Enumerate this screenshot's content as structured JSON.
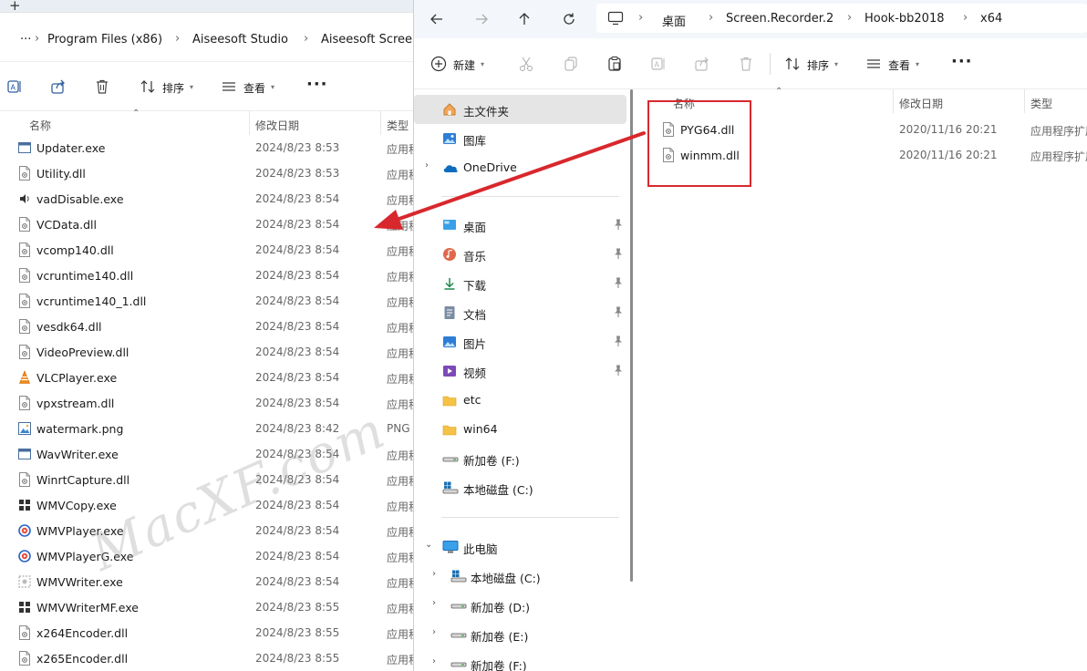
{
  "left": {
    "tab_plus": "+",
    "breadcrumb_more": "···",
    "breadcrumb": [
      "Program Files (x86)",
      "Aiseesoft Studio",
      "Aiseesoft Screen"
    ],
    "toolbar": {
      "sort_label": "排序",
      "view_label": "查看",
      "more": "···"
    },
    "columns": {
      "name": "名称",
      "date": "修改日期",
      "type": "类型"
    },
    "files": [
      {
        "name": "Updater.exe",
        "date": "2024/8/23 8:53",
        "type": "应用程",
        "icon": "app-window-icon"
      },
      {
        "name": "Utility.dll",
        "date": "2024/8/23 8:53",
        "type": "应用程",
        "icon": "dll-file-icon"
      },
      {
        "name": "vadDisable.exe",
        "date": "2024/8/23 8:54",
        "type": "应用程",
        "icon": "speaker-app-icon"
      },
      {
        "name": "VCData.dll",
        "date": "2024/8/23 8:54",
        "type": "应用程",
        "icon": "dll-file-icon"
      },
      {
        "name": "vcomp140.dll",
        "date": "2024/8/23 8:54",
        "type": "应用程",
        "icon": "dll-file-icon"
      },
      {
        "name": "vcruntime140.dll",
        "date": "2024/8/23 8:54",
        "type": "应用程",
        "icon": "dll-file-icon"
      },
      {
        "name": "vcruntime140_1.dll",
        "date": "2024/8/23 8:54",
        "type": "应用程",
        "icon": "dll-file-icon"
      },
      {
        "name": "vesdk64.dll",
        "date": "2024/8/23 8:54",
        "type": "应用程",
        "icon": "dll-file-icon"
      },
      {
        "name": "VideoPreview.dll",
        "date": "2024/8/23 8:54",
        "type": "应用程",
        "icon": "dll-file-icon"
      },
      {
        "name": "VLCPlayer.exe",
        "date": "2024/8/23 8:54",
        "type": "应用程",
        "icon": "vlc-cone-icon"
      },
      {
        "name": "vpxstream.dll",
        "date": "2024/8/23 8:54",
        "type": "应用程",
        "icon": "dll-file-icon"
      },
      {
        "name": "watermark.png",
        "date": "2024/8/23 8:42",
        "type": "PNG",
        "icon": "image-file-icon"
      },
      {
        "name": "WavWriter.exe",
        "date": "2024/8/23 8:54",
        "type": "应用程",
        "icon": "app-window-icon"
      },
      {
        "name": "WinrtCapture.dll",
        "date": "2024/8/23 8:54",
        "type": "应用程",
        "icon": "dll-file-icon"
      },
      {
        "name": "WMVCopy.exe",
        "date": "2024/8/23 8:54",
        "type": "应用程",
        "icon": "grid-app-icon"
      },
      {
        "name": "WMVPlayer.exe",
        "date": "2024/8/23 8:54",
        "type": "应用程",
        "icon": "media-player-icon"
      },
      {
        "name": "WMVPlayerG.exe",
        "date": "2024/8/23 8:54",
        "type": "应用程",
        "icon": "media-player-icon"
      },
      {
        "name": "WMVWriter.exe",
        "date": "2024/8/23 8:54",
        "type": "应用程",
        "icon": "dotted-app-icon"
      },
      {
        "name": "WMVWriterMF.exe",
        "date": "2024/8/23 8:55",
        "type": "应用程",
        "icon": "grid-app-icon"
      },
      {
        "name": "x264Encoder.dll",
        "date": "2024/8/23 8:55",
        "type": "应用程",
        "icon": "dll-file-icon"
      },
      {
        "name": "x265Encoder.dll",
        "date": "2024/8/23 8:55",
        "type": "应用程",
        "icon": "dll-file-icon"
      }
    ]
  },
  "right": {
    "breadcrumb": [
      "桌面",
      "Screen.Recorder.2",
      "Hook-bb2018",
      "x64"
    ],
    "toolbar": {
      "new_label": "新建",
      "sort_label": "排序",
      "view_label": "查看",
      "more": "···"
    },
    "columns": {
      "name": "名称",
      "date": "修改日期",
      "type": "类型"
    },
    "nav_pane": {
      "home": "主文件夹",
      "gallery": "图库",
      "onedrive": "OneDrive",
      "quick": [
        {
          "label": "桌面",
          "icon": "desktop-icon"
        },
        {
          "label": "音乐",
          "icon": "music-icon"
        },
        {
          "label": "下载",
          "icon": "download-icon"
        },
        {
          "label": "文档",
          "icon": "document-icon"
        },
        {
          "label": "图片",
          "icon": "pictures-icon"
        },
        {
          "label": "视频",
          "icon": "video-icon"
        },
        {
          "label": "etc",
          "icon": "folder-icon"
        },
        {
          "label": "win64",
          "icon": "folder-icon"
        },
        {
          "label": "新加卷 (F:)",
          "icon": "drive-icon"
        },
        {
          "label": "本地磁盘 (C:)",
          "icon": "windows-drive-icon"
        }
      ],
      "this_pc": "此电脑",
      "pc_children": [
        {
          "label": "本地磁盘 (C:)",
          "icon": "windows-drive-icon"
        },
        {
          "label": "新加卷 (D:)",
          "icon": "drive-icon"
        },
        {
          "label": "新加卷 (E:)",
          "icon": "drive-icon"
        },
        {
          "label": "新加卷 (F:)",
          "icon": "drive-icon"
        }
      ]
    },
    "files": [
      {
        "name": "PYG64.dll",
        "date": "2020/11/16 20:21",
        "type": "应用程序扩展"
      },
      {
        "name": "winmm.dll",
        "date": "2020/11/16 20:21",
        "type": "应用程序扩展"
      }
    ]
  },
  "watermark": "MacXF.com",
  "colors": {
    "highlight": "#d8282d",
    "arrow": "#d8282d",
    "selection": "#e5e5e5"
  }
}
